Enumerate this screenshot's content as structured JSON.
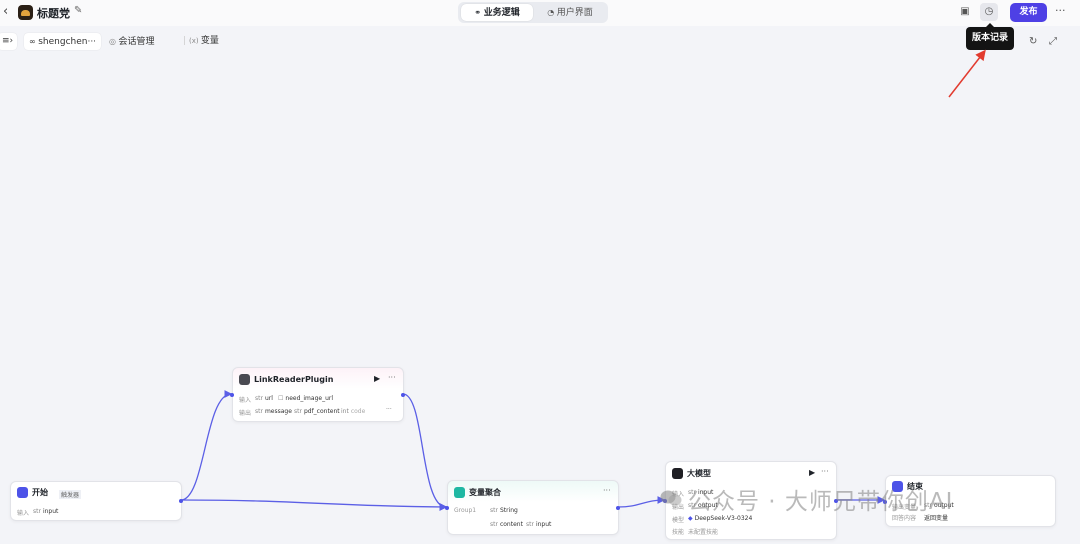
{
  "header": {
    "title": "标题党",
    "tabs": [
      {
        "label": "业务逻辑",
        "active": true
      },
      {
        "label": "用户界面",
        "active": false
      }
    ],
    "publish_label": "发布"
  },
  "subbar": {
    "workflow_tab": "shengchen···",
    "session_label": "会话管理",
    "variables_label": "变量"
  },
  "tooltip": {
    "text": "版本记录"
  },
  "nodes": {
    "start": {
      "title": "开始",
      "badge": "触发器",
      "input_label": "输入",
      "input_tag": "input"
    },
    "plugin": {
      "title": "LinkReaderPlugin",
      "input_label": "输入",
      "inputs": [
        "url",
        "need_image_url"
      ],
      "output_label": "输出",
      "outputs": [
        "message",
        "pdf_content",
        "code"
      ]
    },
    "aggregate": {
      "title": "变量聚合",
      "group_label": "Group1",
      "group_type": "String",
      "items": [
        "content",
        "input"
      ]
    },
    "llm": {
      "title": "大模型",
      "input_label": "输入",
      "input_tag": "input",
      "output_label": "输出",
      "output_tag": "output",
      "model_label": "模型",
      "model_value": "DeepSeek-V3-0324",
      "skill_label": "技能",
      "skill_value": "未配置技能"
    },
    "end": {
      "title": "结束",
      "output_label": "输出变量",
      "output_tag": "output",
      "return_label": "回答内容",
      "return_value": "返回变量"
    }
  },
  "watermark": {
    "text": "公众号 · 大师兄带你创AI"
  },
  "colors": {
    "accent": "#4e40e5",
    "edge": "#5b5fe6",
    "annotation_arrow": "#e23b2f"
  }
}
